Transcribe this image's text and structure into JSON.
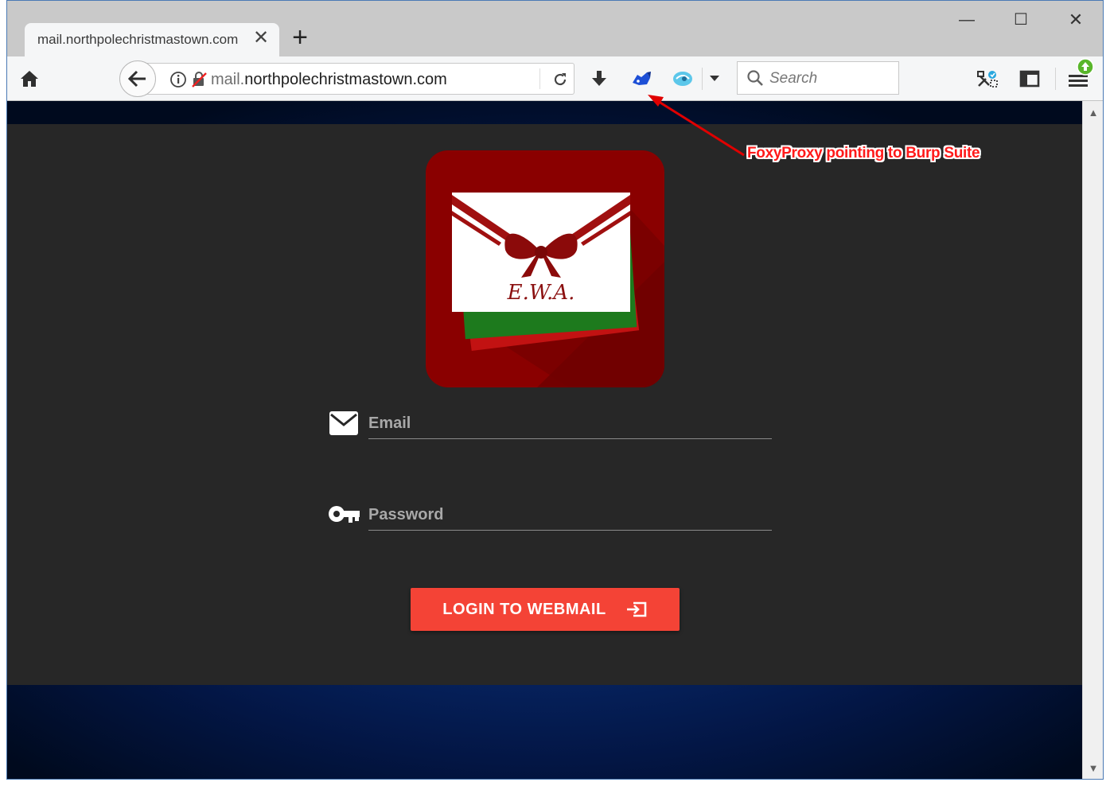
{
  "browser": {
    "tab": {
      "title": "mail.northpolechristmastown.com",
      "close_glyph": "✕"
    },
    "new_tab_glyph": "+",
    "window_controls": {
      "minimize": "—",
      "maximize": "☐",
      "close": "✕"
    },
    "url": {
      "subdomain": "mail.",
      "domain": "northpolechristmastown.com"
    },
    "search_placeholder": "Search",
    "toolbar_icons": [
      "home-icon",
      "back-arrow-icon",
      "info-icon",
      "insecure-lock-icon",
      "reload-icon",
      "download-icon",
      "foxyproxy-icon",
      "extension-icon",
      "dropdown-icon",
      "search-icon",
      "extension-tools-icon",
      "sidebar-icon",
      "menu-icon",
      "update-badge-icon"
    ]
  },
  "page": {
    "logo_text": "E.W.A.",
    "email_label": "Email",
    "password_label": "Password",
    "login_button": "LOGIN TO WEBMAIL",
    "accent_color": "#f44336",
    "logo_color": "#8a0000"
  },
  "annotation": {
    "text": "FoxyProxy pointing to Burp Suite",
    "color": "#ff1a1a"
  }
}
